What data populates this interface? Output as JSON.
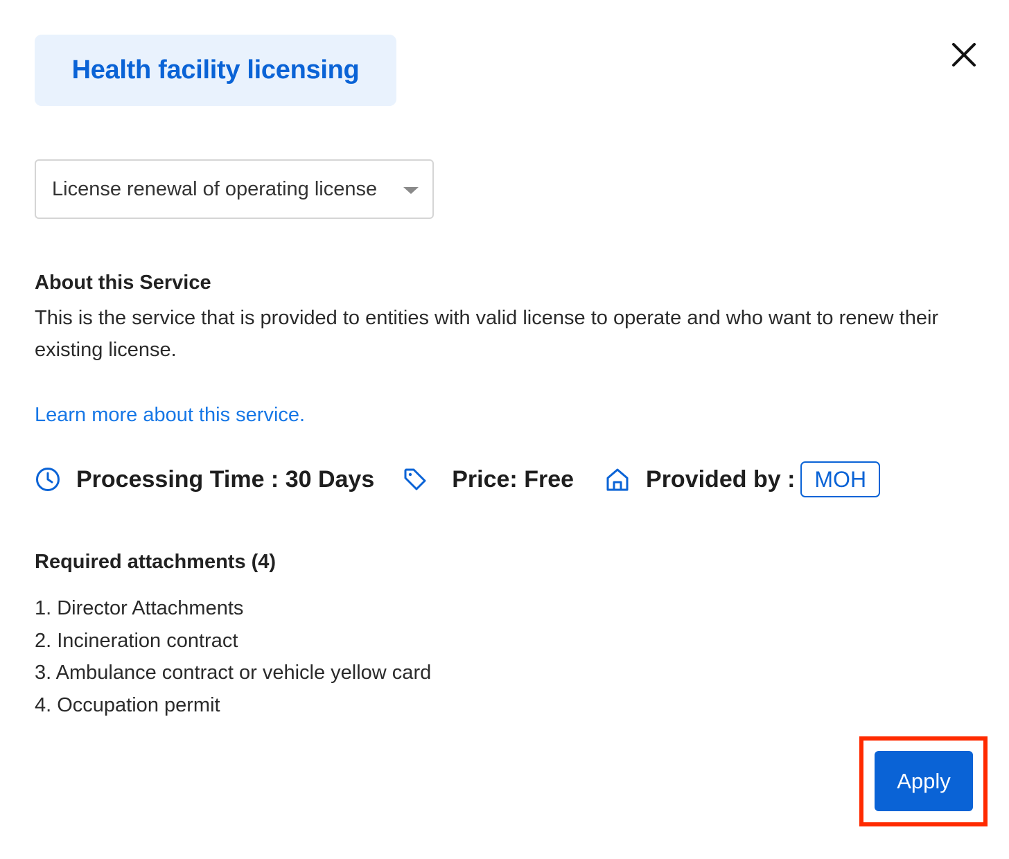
{
  "header": {
    "title": "Health facility licensing"
  },
  "dialog": {
    "close_icon": "close-icon"
  },
  "service_select": {
    "selected": "License renewal of operating license",
    "icon": "chevron-down-icon"
  },
  "about": {
    "heading": "About this Service",
    "description": "This is the service that is provided to entities with valid license to operate and who want to renew their existing license.",
    "learn_more_link": "Learn more about this service."
  },
  "meta": {
    "processing_time": "Processing Time : 30 Days",
    "processing_icon": "clock-icon",
    "price": "Price: Free",
    "price_icon": "tag-icon",
    "provided_by_label": "Provided by :",
    "provider_icon": "home-icon",
    "provider": "MOH"
  },
  "attachments": {
    "heading": "Required attachments (4)",
    "items": [
      "1. Director Attachments",
      "2. Incineration contract",
      "3. Ambulance contract or vehicle yellow card",
      "4. Occupation permit"
    ]
  },
  "actions": {
    "apply_label": "Apply"
  },
  "colors": {
    "primary": "#0a63d6",
    "link": "#1677e6",
    "chip_background": "#e9f2fd",
    "highlight": "#ff2a00"
  }
}
